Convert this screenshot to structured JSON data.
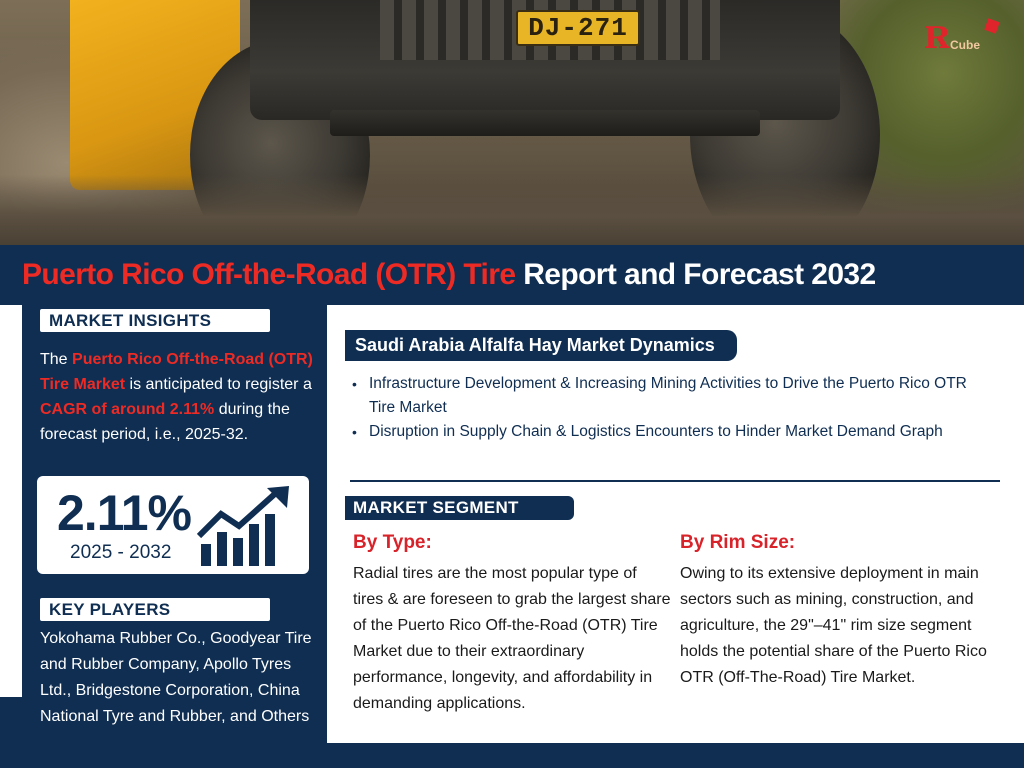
{
  "hero": {
    "plate_text": "DJ-271",
    "logo_mark": "Я",
    "logo_word": "Cube"
  },
  "title": {
    "red": "Puerto Rico Off-the-Road (OTR) Tire",
    "white": " Report and Forecast 2032"
  },
  "market_insights": {
    "label": "MARKET INSIGHTS",
    "text_1": "The ",
    "highlight_1": "Puerto Rico Off-the-Road (OTR) Tire Market",
    "text_2": " is anticipated to register a ",
    "highlight_2": "CAGR of around 2.11%",
    "text_3": " during the forecast period, i.e., 2025-32."
  },
  "stat": {
    "value": "2.11%",
    "period": "2025 - 2032"
  },
  "key_players": {
    "label": "KEY PLAYERS",
    "text": "Yokohama Rubber Co., Goodyear Tire and Rubber Company, Apollo Tyres Ltd., Bridgestone Corporation, China National Tyre and Rubber, and Others"
  },
  "dynamics": {
    "label": "Saudi Arabia Alfalfa Hay Market Dynamics",
    "bullets": [
      "Infrastructure Development & Increasing Mining Activities to Drive the Puerto Rico OTR Tire Market",
      "Disruption in Supply Chain & Logistics Encounters to Hinder Market Demand Graph"
    ]
  },
  "segment": {
    "label": "MARKET SEGMENT",
    "by_type_heading": "By Type:",
    "by_type_text": "Radial tires are the most popular type of tires & are foreseen to grab the largest share of the Puerto Rico Off-the-Road (OTR) Tire Market due to their extraordinary performance, longevity, and affordability in demanding applications.",
    "by_rim_heading": "By Rim Size:",
    "by_rim_text": "Owing to its extensive deployment in main sectors such as mining, construction, and agriculture, the 29\"–41\" rim size segment holds the potential share of the Puerto Rico OTR (Off-The-Road) Tire Market."
  },
  "colors": {
    "navy": "#0f2e52",
    "red": "#ee2a24",
    "heading_red": "#d8232a",
    "white": "#ffffff"
  },
  "icons": {
    "growth": "bar-chart-growth-arrow-icon"
  }
}
